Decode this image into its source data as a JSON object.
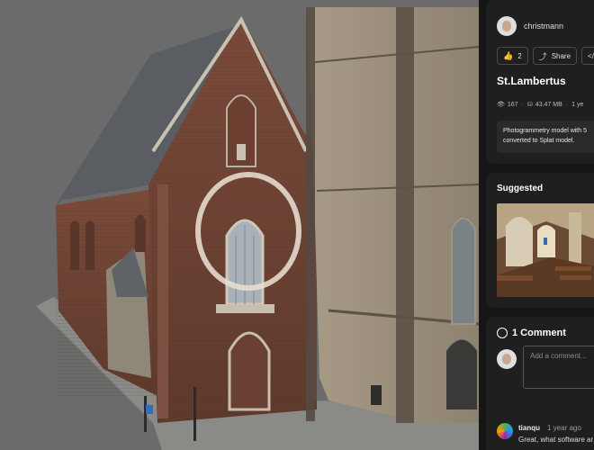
{
  "author": {
    "name": "christmann"
  },
  "actions": {
    "like_count": "2",
    "share_label": "Share",
    "embed_label": "</>",
    "like_icon": "thumbs-up-icon",
    "share_icon": "share-icon"
  },
  "model": {
    "title": "St.Lambertus",
    "views": "167",
    "size": "43.47 MB",
    "age": "1 ye",
    "description_line1": "Photogrammetry model with 5",
    "description_line2": "converted to Splat model."
  },
  "suggested": {
    "heading": "Suggested"
  },
  "comments": {
    "heading": "1 Comment",
    "placeholder": "Add a comment...",
    "items": [
      {
        "user": "tianqu",
        "time": "1 year ago",
        "text": "Great, what software ar"
      }
    ]
  },
  "colors": {
    "viewer_background": "#6b6b6b",
    "panel_background": "#161616",
    "card_background": "#1f1f1f"
  }
}
